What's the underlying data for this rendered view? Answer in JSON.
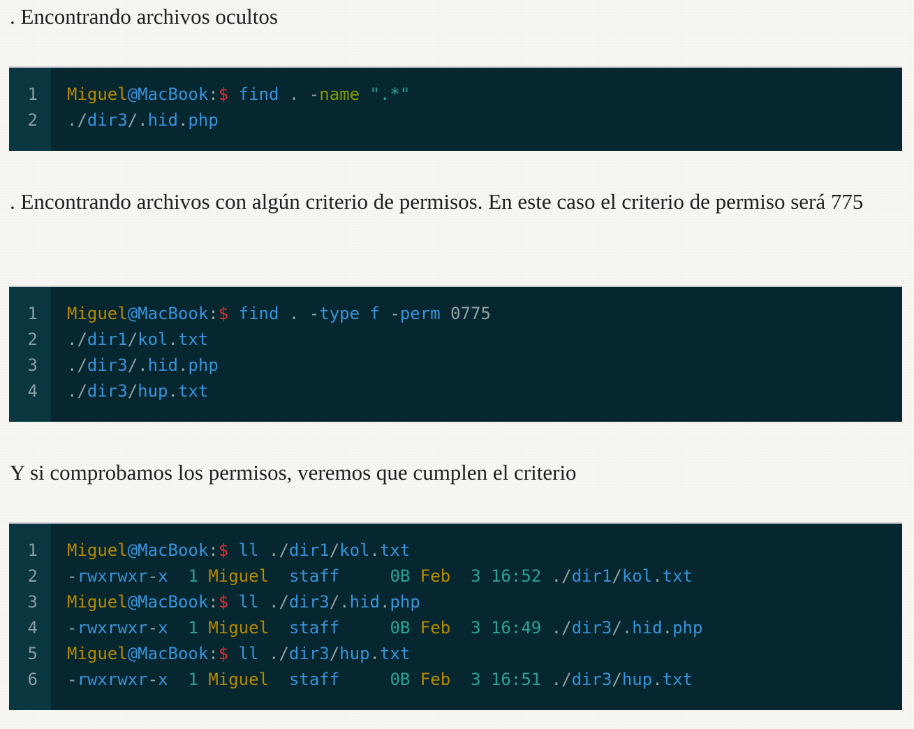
{
  "paragraphs": [
    ". Encontrando archivos ocultos",
    ". Encontrando archivos con algún criterio de permisos. En este caso el criterio de permiso será 775",
    "Y si comprobamos los permisos, veremos que cumplen el criterio"
  ],
  "colors": {
    "user": "#b58900",
    "host": "#3a92d8",
    "prompt": "#dc322f",
    "keyword": "#3a92d8",
    "option_name": "#859900",
    "string": "#2aa198",
    "default": "#93a1a1"
  },
  "code_blocks": [
    {
      "line_numbers": [
        "1",
        "2"
      ],
      "lines": [
        [
          [
            "Miguel",
            "y"
          ],
          [
            "@MacBook",
            "b"
          ],
          [
            ":",
            "p"
          ],
          [
            "$",
            "r"
          ],
          [
            " ",
            "p"
          ],
          [
            "find",
            "b"
          ],
          [
            " . -",
            "p"
          ],
          [
            "name",
            "g"
          ],
          [
            " ",
            "p"
          ],
          [
            "\".*\"",
            "c"
          ]
        ],
        [
          [
            "./",
            "p"
          ],
          [
            "dir3",
            "b"
          ],
          [
            "/.",
            "p"
          ],
          [
            "hid",
            "b"
          ],
          [
            ".",
            "p"
          ],
          [
            "php",
            "b"
          ]
        ]
      ]
    },
    {
      "line_numbers": [
        "1",
        "2",
        "3",
        "4"
      ],
      "lines": [
        [
          [
            "Miguel",
            "y"
          ],
          [
            "@MacBook",
            "b"
          ],
          [
            ":",
            "p"
          ],
          [
            "$",
            "r"
          ],
          [
            " ",
            "p"
          ],
          [
            "find",
            "b"
          ],
          [
            " . -",
            "p"
          ],
          [
            "type",
            "b"
          ],
          [
            " ",
            "p"
          ],
          [
            "f",
            "b"
          ],
          [
            " -",
            "p"
          ],
          [
            "perm",
            "b"
          ],
          [
            " 0775",
            "p"
          ]
        ],
        [
          [
            "./",
            "p"
          ],
          [
            "dir1",
            "b"
          ],
          [
            "/",
            "p"
          ],
          [
            "kol",
            "b"
          ],
          [
            ".",
            "p"
          ],
          [
            "txt",
            "b"
          ]
        ],
        [
          [
            "./",
            "p"
          ],
          [
            "dir3",
            "b"
          ],
          [
            "/.",
            "p"
          ],
          [
            "hid",
            "b"
          ],
          [
            ".",
            "p"
          ],
          [
            "php",
            "b"
          ]
        ],
        [
          [
            "./",
            "p"
          ],
          [
            "dir3",
            "b"
          ],
          [
            "/",
            "p"
          ],
          [
            "hup",
            "b"
          ],
          [
            ".",
            "p"
          ],
          [
            "txt",
            "b"
          ]
        ]
      ]
    },
    {
      "line_numbers": [
        "1",
        "2",
        "3",
        "4",
        "5",
        "6"
      ],
      "lines": [
        [
          [
            "Miguel",
            "y"
          ],
          [
            "@MacBook",
            "b"
          ],
          [
            ":",
            "p"
          ],
          [
            "$",
            "r"
          ],
          [
            " ",
            "p"
          ],
          [
            "ll",
            "b"
          ],
          [
            " ./",
            "p"
          ],
          [
            "dir1",
            "b"
          ],
          [
            "/",
            "p"
          ],
          [
            "kol",
            "b"
          ],
          [
            ".",
            "p"
          ],
          [
            "txt",
            "b"
          ]
        ],
        [
          [
            "-",
            "p"
          ],
          [
            "rwxrwxr",
            "b"
          ],
          [
            "-",
            "p"
          ],
          [
            "x",
            "b"
          ],
          [
            "  ",
            "p"
          ],
          [
            "1",
            "c"
          ],
          [
            " ",
            "p"
          ],
          [
            "Miguel",
            "y"
          ],
          [
            "  ",
            "p"
          ],
          [
            "staff",
            "b"
          ],
          [
            "     ",
            "p"
          ],
          [
            "0B",
            "c"
          ],
          [
            " ",
            "p"
          ],
          [
            "Feb",
            "y"
          ],
          [
            "  ",
            "p"
          ],
          [
            "3",
            "c"
          ],
          [
            " ",
            "p"
          ],
          [
            "16:52",
            "c"
          ],
          [
            " ./",
            "p"
          ],
          [
            "dir1",
            "b"
          ],
          [
            "/",
            "p"
          ],
          [
            "kol",
            "b"
          ],
          [
            ".",
            "p"
          ],
          [
            "txt",
            "b"
          ]
        ],
        [
          [
            "Miguel",
            "y"
          ],
          [
            "@MacBook",
            "b"
          ],
          [
            ":",
            "p"
          ],
          [
            "$",
            "r"
          ],
          [
            " ",
            "p"
          ],
          [
            "ll",
            "b"
          ],
          [
            " ./",
            "p"
          ],
          [
            "dir3",
            "b"
          ],
          [
            "/.",
            "p"
          ],
          [
            "hid",
            "b"
          ],
          [
            ".",
            "p"
          ],
          [
            "php",
            "b"
          ]
        ],
        [
          [
            "-",
            "p"
          ],
          [
            "rwxrwxr",
            "b"
          ],
          [
            "-",
            "p"
          ],
          [
            "x",
            "b"
          ],
          [
            "  ",
            "p"
          ],
          [
            "1",
            "c"
          ],
          [
            " ",
            "p"
          ],
          [
            "Miguel",
            "y"
          ],
          [
            "  ",
            "p"
          ],
          [
            "staff",
            "b"
          ],
          [
            "     ",
            "p"
          ],
          [
            "0B",
            "c"
          ],
          [
            " ",
            "p"
          ],
          [
            "Feb",
            "y"
          ],
          [
            "  ",
            "p"
          ],
          [
            "3",
            "c"
          ],
          [
            " ",
            "p"
          ],
          [
            "16:49",
            "c"
          ],
          [
            " ./",
            "p"
          ],
          [
            "dir3",
            "b"
          ],
          [
            "/.",
            "p"
          ],
          [
            "hid",
            "b"
          ],
          [
            ".",
            "p"
          ],
          [
            "php",
            "b"
          ]
        ],
        [
          [
            "Miguel",
            "y"
          ],
          [
            "@MacBook",
            "b"
          ],
          [
            ":",
            "p"
          ],
          [
            "$",
            "r"
          ],
          [
            " ",
            "p"
          ],
          [
            "ll",
            "b"
          ],
          [
            " ./",
            "p"
          ],
          [
            "dir3",
            "b"
          ],
          [
            "/",
            "p"
          ],
          [
            "hup",
            "b"
          ],
          [
            ".",
            "p"
          ],
          [
            "txt",
            "b"
          ]
        ],
        [
          [
            "-",
            "p"
          ],
          [
            "rwxrwxr",
            "b"
          ],
          [
            "-",
            "p"
          ],
          [
            "x",
            "b"
          ],
          [
            "  ",
            "p"
          ],
          [
            "1",
            "c"
          ],
          [
            " ",
            "p"
          ],
          [
            "Miguel",
            "y"
          ],
          [
            "  ",
            "p"
          ],
          [
            "staff",
            "b"
          ],
          [
            "     ",
            "p"
          ],
          [
            "0B",
            "c"
          ],
          [
            " ",
            "p"
          ],
          [
            "Feb",
            "y"
          ],
          [
            "  ",
            "p"
          ],
          [
            "3",
            "c"
          ],
          [
            " ",
            "p"
          ],
          [
            "16:51",
            "c"
          ],
          [
            " ./",
            "p"
          ],
          [
            "dir3",
            "b"
          ],
          [
            "/",
            "p"
          ],
          [
            "hup",
            "b"
          ],
          [
            ".",
            "p"
          ],
          [
            "txt",
            "b"
          ]
        ]
      ]
    }
  ]
}
